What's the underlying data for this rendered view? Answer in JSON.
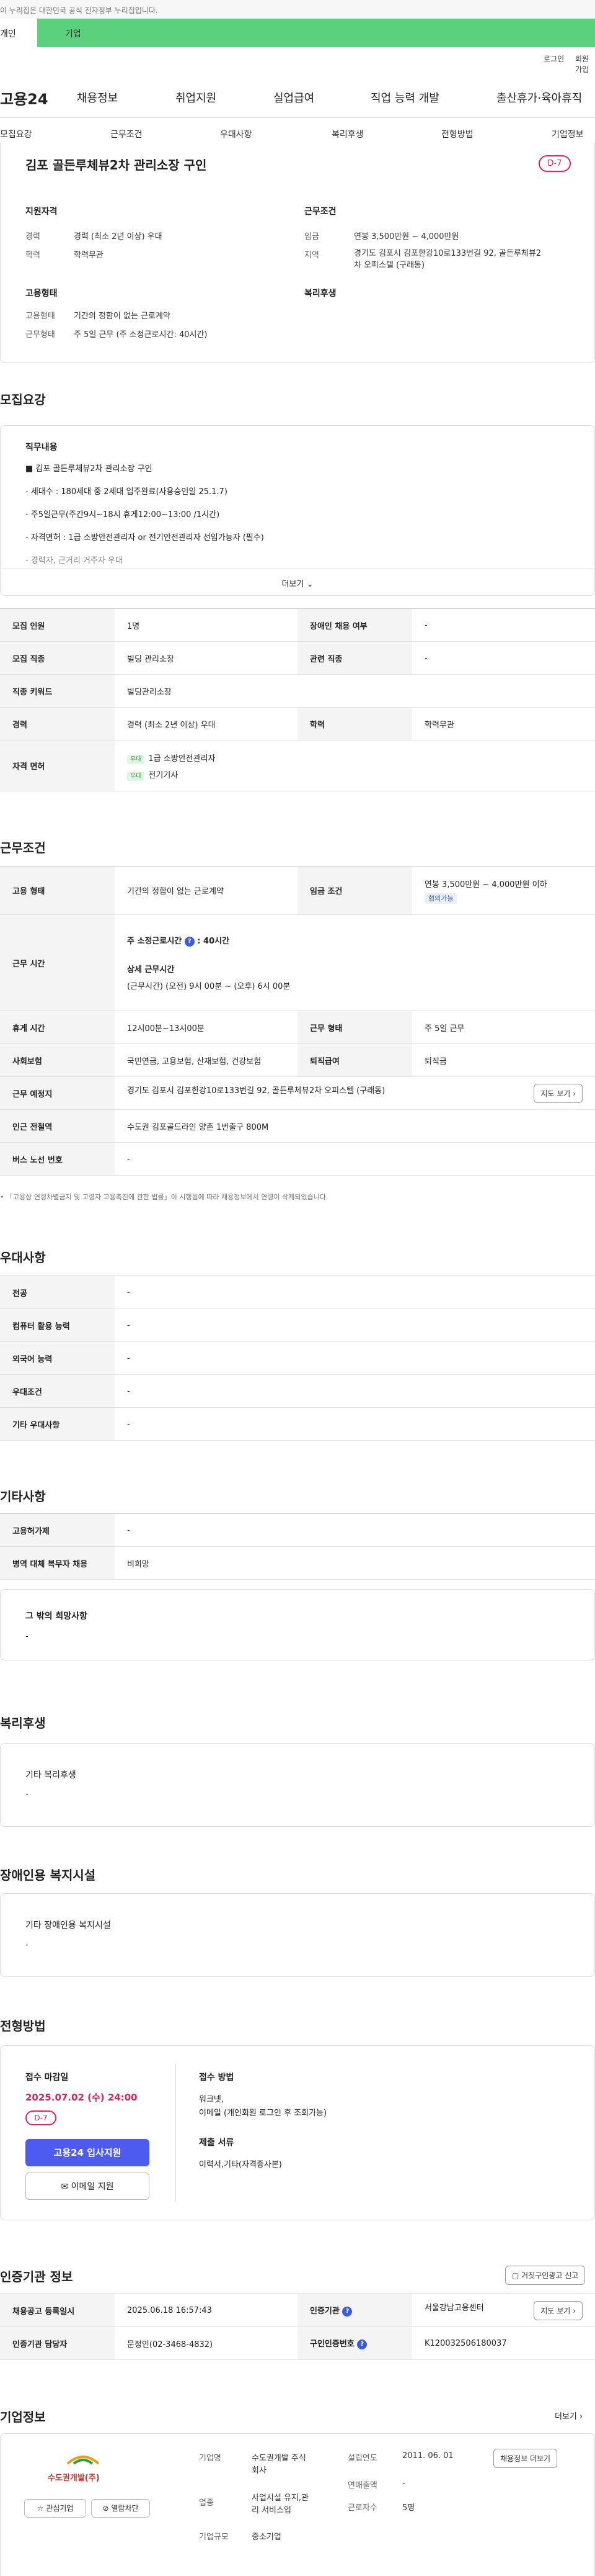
{
  "gov_notice": "이 누리집은 대한민국 공식 전자정부 누리집입니다.",
  "tabs": {
    "person": "개인",
    "biz": "기업"
  },
  "util": {
    "login": "로그인",
    "signup": "회원가입"
  },
  "gnb": {
    "logo": "고용24",
    "menus": [
      "채용정보",
      "취업지원",
      "실업급여",
      "직업 능력 개발",
      "출산휴가·육아휴직"
    ]
  },
  "subnav": [
    "모집요강",
    "근무조건",
    "우대사항",
    "복리후생",
    "전형방법",
    "기업정보"
  ],
  "summary": {
    "title": "김포 골든루체뷰2차 관리소장 구인",
    "dday": "D-7",
    "qual_h": "지원자격",
    "work_h": "근무조건",
    "emp_h": "고용형태",
    "welfare_h": "복리후생",
    "career_k": "경력",
    "career_v": "경력 (최소 2년 이상) 우대",
    "edu_k": "학력",
    "edu_v": "학력무관",
    "wage_k": "임금",
    "wage_v": "연봉 3,500만원 ~ 4,000만원",
    "loc_k": "지역",
    "loc_v1": "경기도 김포시 김포한강10로133번길 92, 골든루체뷰2",
    "loc_v2": "차 오피스텔 (구래동)",
    "etype_k": "고용형태",
    "etype_v": "기간의 정함이 없는 근로계약",
    "wtype_k": "근무형태",
    "wtype_v": "주 5일 근무 (주 소정근로시간: 40시간)"
  },
  "recruit": {
    "h": "모집요강",
    "duty_h": "직무내용",
    "lines": [
      "김포 골든루체뷰2차 관리소장 구인",
      "- 세대수 : 180세대 중 2세대 입주완료(사용승인일 25.1.7)",
      "- 주5일근무(주간9시~18시 휴게12:00~13:00 /1시간)",
      "- 자격면허 : 1급 소방안전관리자 or 전기안전관리자 선임가능자 (필수)",
      "- 경력자, 근거리 거주자 우대"
    ],
    "more": "더보기",
    "rows": {
      "count_k": "모집 인원",
      "count_v": "1명",
      "dis_k": "장애인 채용 여부",
      "dis_v": "-",
      "job_k": "모집 직종",
      "job_v": "빌딩 관리소장",
      "rel_k": "관련 직종",
      "rel_v": "-",
      "kw_k": "직종 키워드",
      "kw_v": "빌딩관리소장",
      "car_k": "경력",
      "car_v": "경력 (최소 2년 이상) 우대",
      "edu_k": "학력",
      "edu_v": "학력무관",
      "lic_k": "자격 면허",
      "tag": "우대",
      "lic1": "1급 소방안전관리자",
      "lic2": "전기기사"
    }
  },
  "cond": {
    "h": "근무조건",
    "etype_k": "고용 형태",
    "etype_v": "기간의 정함이 없는 근로계약",
    "wage_k": "임금 조건",
    "wage_v": "연봉 3,500만원 ~ 4,000만원 이하",
    "wage_tag": "협의가능",
    "time_k": "근무 시간",
    "week_label": "주 소정근로시간",
    "week_v": "40시간",
    "detail_h": "상세 근무시간",
    "detail_v": "(근무시간) (오전) 9시 00분 ~ (오후) 6시 00분",
    "rest_k": "휴게 시간",
    "rest_v": "12시00분~13시00분",
    "form_k": "근무 형태",
    "form_v": "주 5일 근무",
    "ins_k": "사회보험",
    "ins_v": "국민연금, 고용보험, 산재보험, 건강보험",
    "ret_k": "퇴직급여",
    "ret_v": "퇴직금",
    "place_k": "근무 예정지",
    "place_v": "경기도 김포시 김포한강10로133번길 92, 골든루체뷰2차 오피스텔 (구래동)",
    "map": "지도 보기",
    "sub_k": "인근 전철역",
    "sub_v": "수도권 김포골드라인 양촌 1번출구 800M",
    "bus_k": "버스 노선 번호",
    "bus_v": "-",
    "note": "「고용상 연령차별금지 및 고령자 고용촉진에 관한 법률」이 시행됨에 따라 채용정보에서 연령이 삭제되었습니다."
  },
  "pref": {
    "h": "우대사항",
    "rows": [
      [
        "전공",
        "-"
      ],
      [
        "컴퓨터 활용 능력",
        "-"
      ],
      [
        "외국어 능력",
        "-"
      ],
      [
        "우대조건",
        "-"
      ],
      [
        "기타 우대사항",
        "-"
      ]
    ]
  },
  "etc": {
    "h": "기타사항",
    "rows": [
      [
        "고용허가제",
        "-"
      ],
      [
        "병역 대체 복무자 채용",
        "비희망"
      ]
    ],
    "wish_h": "그 밖의 희망사항",
    "wish_v": "-"
  },
  "welfare": {
    "h": "복리후생",
    "sub": "기타 복리후생",
    "v": "-"
  },
  "disab": {
    "h": "장애인용 복지시설",
    "sub": "기타 장애인용 복지시설",
    "v": "-"
  },
  "process": {
    "h": "전형방법",
    "deadline_h": "접수 마감일",
    "deadline": "2025.07.02 (수) 24:00",
    "dday": "D-7",
    "apply": "고용24 입사지원",
    "email": "이메일 지원",
    "method_h": "접수 방법",
    "method1": "워크넷,",
    "method2": "이메일 (개인회원 로그인 후 조회가능)",
    "docs_h": "제출 서류",
    "docs": "이력서,기타(자격증사본)"
  },
  "agency": {
    "h": "인증기관 정보",
    "report": "거짓구인광고 신고",
    "reg_k": "채용공고 등록일시",
    "reg_v": "2025.06.18 16:57:43",
    "org_k": "인증기관",
    "org_v": "서울강남고용센터",
    "map": "지도 보기",
    "mgr_k": "인증기관 담당자",
    "mgr_v": "문정인(02-3468-4832)",
    "num_k": "구인인증번호",
    "num_v": "K120032506180037"
  },
  "company": {
    "h": "기업정보",
    "more": "더보기",
    "logo": "수도권개발(주)",
    "fav": "관심기업",
    "block": "열람차단",
    "name_k": "기업명",
    "name_v1": "수도권개발 주식",
    "name_v2": "회사",
    "year_k": "설립연도",
    "year_v": "2011. 06. 01",
    "list": "채용정보 더보기",
    "ind_k": "업종",
    "ind_v1": "사업시설 유지,관",
    "ind_v2": "리 서비스업",
    "sales_k": "연매출액",
    "sales_v": "-",
    "emp_k": "근로자수",
    "emp_v": "5명",
    "size_k": "기업규모",
    "size_v": "중소기업"
  }
}
